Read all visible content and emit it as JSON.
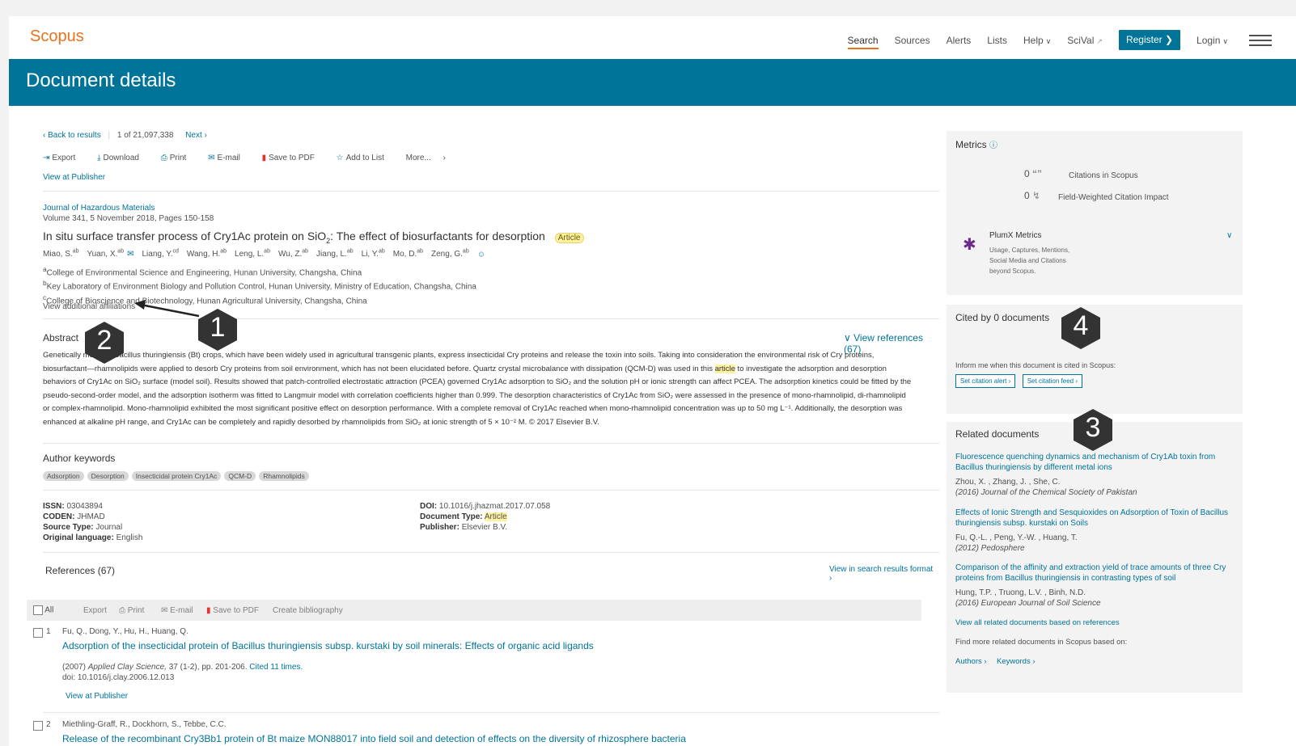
{
  "header": {
    "logo": "Scopus",
    "nav": [
      {
        "label": "Search",
        "active": true
      },
      {
        "label": "Sources"
      },
      {
        "label": "Alerts"
      },
      {
        "label": "Lists"
      },
      {
        "label": "Help",
        "dropdown": true
      },
      {
        "label": "SciVal",
        "external": true
      }
    ],
    "register": "Register",
    "login": "Login"
  },
  "banner": {
    "title": "Document details"
  },
  "pager": {
    "back": "Back to results",
    "position": "1  of  21,097,338",
    "next": "Next"
  },
  "tools": {
    "export": "Export",
    "download": "Download",
    "print": "Print",
    "email": "E-mail",
    "save_pdf": "Save to PDF",
    "add_list": "Add to List",
    "more": "More...",
    "view_publisher": "View at Publisher"
  },
  "doc": {
    "journal": "Journal of Hazardous Materials",
    "volume": "Volume 341, 5 November 2018, Pages 150-158",
    "title_a": "In situ surface transfer process of Cry1Ac protein on SiO",
    "title_sub": "2",
    "title_b": ":   The effect of biosurfactants for desorption",
    "badge": "Article",
    "authors": [
      "Miao, S.",
      "Yuan, X.",
      "Liang, Y.",
      "Wang, H.",
      "Leng, L.",
      "Wu, Z.",
      "Jiang, L.",
      "Li, Y.",
      "Mo, D.",
      "Zeng, G."
    ],
    "author_sups": [
      "ab",
      "ab",
      "cd",
      "ab",
      "ab",
      "ab",
      "ab",
      "ab",
      "ab",
      "ab"
    ],
    "affiliations": [
      {
        "sup": "a",
        "text": "College of Environmental Science and Engineering, Hunan University, Changsha, China"
      },
      {
        "sup": "b",
        "text": "Key Laboratory of Environment Biology and Pollution Control, Hunan University, Ministry of Education, Changsha, China"
      },
      {
        "sup": "c",
        "text": "College of Bioscience and Biotechnology, Hunan Agricultural University, Changsha, China"
      }
    ],
    "view_affiliations": "View additional affiliations"
  },
  "abstract": {
    "heading": "Abstract",
    "view_refs": "View references (67)",
    "l1": "Genetically modified Bacillus thuringiensis (Bt) crops, which have been widely used in agricultural transgenic plants, express insecticidal Cry proteins and release the toxin into soils. Taking into consideration the environmental risk of Cry proteins,",
    "l2a": "biosurfactant—rhamnolipids were applied to desorb Cry proteins from soil environment, which has not been elucidated before. Quartz crystal microbalance with dissipation (QCM-D) was used in this ",
    "l2hl": "article",
    "l2b": " to investigate the adsorption and desorption",
    "l3": "behaviors of Cry1Ac on SiO₂ surface (model soil). Results showed that patch-controlled electrostatic attraction (PCEA) governed Cry1Ac adsorption to SiO₂ and the solution pH or ionic strength can affect PCEA. The adsorption kinetics could be fitted by the",
    "l4": "pseudo-second-order model, and the adsorption isotherm was fitted to Langmuir model with correlation coefficients higher than 0.999. The desorption characteristics of Cry1Ac from SiO₂ were assessed in the presence of mono-rhamnolipid, di-rhamnolipid",
    "l5": "or complex-rhamnolipid. Mono-rhamnolipid exhibited the most significant positive effect on desorption performance. With a complete removal of Cry1Ac reached when mono-rhamnolipid concentration was up to 50 mg L⁻¹. Additionally, the desorption was",
    "l6": "enhanced at alkaline pH range, and Cry1Ac can be completely and rapidly desorbed by rhamnolipids from SiO₂ at ionic strength of 5 × 10⁻² M. © 2017 Elsevier B.V."
  },
  "keywords": {
    "heading": "Author keywords",
    "items": [
      "Adsorption",
      "Desorption",
      "Insecticidal protein Cry1Ac",
      "QCM-D",
      "Rhamnolipids"
    ]
  },
  "meta": {
    "issn_label": "ISSN:",
    "issn": "03043894",
    "coden_label": "CODEN:",
    "coden": "JHMAD",
    "source_label": "Source Type:",
    "source": "Journal",
    "lang_label": "Original language:",
    "lang": "English",
    "doi_label": "DOI:",
    "doi": "10.1016/j.jhazmat.2017.07.058",
    "type_label": "Document Type:",
    "type": "Article",
    "pub_label": "Publisher:",
    "pub": "Elsevier B.V."
  },
  "references": {
    "heading": "References (67)",
    "view_search": "View in search results format",
    "toolbar": {
      "all": "All",
      "export": "Export",
      "print": "Print",
      "email": "E-mail",
      "save_pdf": "Save to PDF",
      "bib": "Create bibliography"
    },
    "items": [
      {
        "num": "1",
        "authors": "Fu, Q., Dong, Y., Hu, H., Huang, Q.",
        "title": "Adsorption of the insecticidal protein of Bacillus thuringiensis subsp. kurstaki by soil minerals: Effects of organic acid ligands",
        "year": "(2007)",
        "journal": "Applied Clay Science,",
        "rest": " 37 (1-2), pp. 201-206.",
        "cited": "Cited 11 times.",
        "doi": "doi: 10.1016/j.clay.2006.12.013",
        "publisher": "View at Publisher"
      },
      {
        "num": "2",
        "authors": "Miethling-Graff, R., Dockhorn, S., Tebbe, C.C.",
        "title": "Release of the recombinant Cry3Bb1 protein of Bt maize MON88017 into field soil and detection of effects on the diversity of rhizosphere bacteria"
      }
    ]
  },
  "metrics": {
    "heading": "Metrics",
    "citations_value": "0",
    "citations_label": "Citations in Scopus",
    "fwci_value": "0",
    "fwci_label": "Field-Weighted Citation Impact",
    "plumx_title": "PlumX Metrics",
    "plumx_desc": [
      "Usage, Captures, Mentions,",
      "Social Media and Citations",
      "beyond Scopus."
    ]
  },
  "cited": {
    "heading": "Cited by 0 documents",
    "inform": "Inform me when this document is cited in Scopus:",
    "alert_btn": "Set citation alert",
    "feed_btn": "Set citation feed"
  },
  "related": {
    "heading": "Related documents",
    "items": [
      {
        "title": "Fluorescence quenching dynamics and mechanism of Cry1Ab toxin from Bacillus thuringiensis by different metal ions",
        "authors": "Zhou, X. , Zhang, J. , She, C.",
        "source": "(2016) Journal of the Chemical Society of Pakistan"
      },
      {
        "title": "Effects of Ionic Strength and Sesquioxides on Adsorption of Toxin of Bacillus thuringiensis subsp. kurstaki on Soils",
        "authors": "Fu, Q.-L. , Peng, Y.-W. , Huang, T.",
        "source": "(2012) Pedosphere"
      },
      {
        "title": "Comparison of the affinity and extraction yield of trace amounts of three Cry proteins from Bacillus thuringiensis in contrasting types of soil",
        "authors": "Hung, T.P. , Truong, L.V. , Binh, N.D.",
        "source": "(2016) European Journal of Soil Science"
      }
    ],
    "view_all": "View all related documents based on references",
    "find_more": "Find more related documents in Scopus based on:",
    "authors_link": "Authors",
    "keywords_link": "Keywords"
  },
  "callouts": [
    "1",
    "2",
    "3",
    "4"
  ]
}
